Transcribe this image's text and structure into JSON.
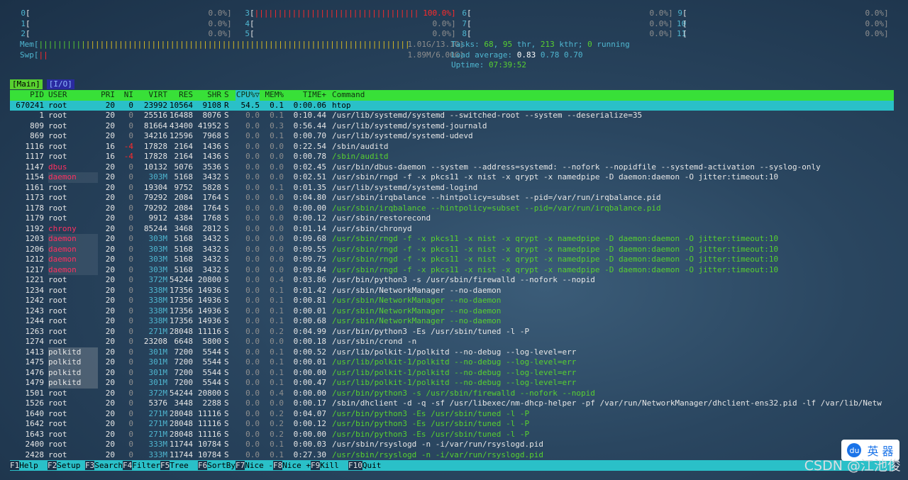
{
  "cpus": [
    {
      "n": "0",
      "pct": "0.0%]",
      "bar": ""
    },
    {
      "n": "1",
      "pct": "0.0%]",
      "bar": ""
    },
    {
      "n": "2",
      "pct": "0.0%]",
      "bar": ""
    },
    {
      "n": "3",
      "pct": "100.0%]",
      "bar": "||||||||||||||||||||||||||||||||||||||||||||||||||||||||||"
    },
    {
      "n": "4",
      "pct": "0.0%]",
      "bar": ""
    },
    {
      "n": "5",
      "pct": "0.0%]",
      "bar": ""
    },
    {
      "n": "6",
      "pct": "0.0%]",
      "bar": ""
    },
    {
      "n": "7",
      "pct": "0.0%]",
      "bar": ""
    },
    {
      "n": "8",
      "pct": "0.0%]",
      "bar": ""
    },
    {
      "n": "9",
      "pct": "0.0%]",
      "bar": ""
    },
    {
      "n": "10",
      "pct": "0.0%]",
      "bar": ""
    },
    {
      "n": "11",
      "pct": "0.0%]",
      "bar": ""
    }
  ],
  "mem": {
    "label": "Mem[",
    "bar": "||||||||||||||||||||||||||||||||||||||||||||||||||||||||||||||||||||||||||||||||||||||||||||||||||||||||||||||||||||||||||||||||||",
    "value": "1.01G/13.1G]"
  },
  "swp": {
    "label": "Swp[",
    "bar": "||",
    "value": "1.89M/6.00G]"
  },
  "tasks": {
    "label": "Tasks: ",
    "tasks": "68",
    "sep1": ", ",
    "thr": "95",
    "thr_label": " thr, ",
    "kthr": "213",
    "kthr_label": " kthr; ",
    "running": "0",
    "running_label": " running"
  },
  "load": {
    "label": "Load average: ",
    "v1": "0.83",
    "v2": "0.78",
    "v3": "0.70"
  },
  "uptime": {
    "label": "Uptime: ",
    "value": "07:39:52"
  },
  "tabs": {
    "main": "[Main]",
    "io": "[I/O]"
  },
  "header": {
    "pid": "PID",
    "user": "USER",
    "pri": "PRI",
    "ni": "NI",
    "virt": "VIRT",
    "res": "RES",
    "shr": "SHR",
    "s": "S",
    "cpu": "CPU%▽",
    "mem": "MEM%",
    "time": "TIME+",
    "cmd": "Command"
  },
  "processes": [
    {
      "pid": "670241",
      "user": "root",
      "pri": "20",
      "ni": "0",
      "virt": "23992",
      "res": "10564",
      "shr": "9108",
      "s": "R",
      "cpu": "54.5",
      "mem": "0.1",
      "time": "0:00.06",
      "cmd": "htop",
      "sel": true
    },
    {
      "pid": "1",
      "user": "root",
      "pri": "20",
      "ni": "0",
      "virt": "25516",
      "res": "16488",
      "shr": "8076",
      "s": "S",
      "cpu": "0.0",
      "mem": "0.1",
      "time": "0:10.44",
      "cmd": "/usr/lib/systemd/systemd --switched-root --system --deserialize=35"
    },
    {
      "pid": "809",
      "user": "root",
      "pri": "20",
      "ni": "0",
      "virt": "81664",
      "res": "43400",
      "shr": "41952",
      "s": "S",
      "cpu": "0.0",
      "mem": "0.3",
      "time": "0:56.44",
      "cmd": "/usr/lib/systemd/systemd-journald"
    },
    {
      "pid": "869",
      "user": "root",
      "pri": "20",
      "ni": "0",
      "virt": "34216",
      "res": "12596",
      "shr": "7968",
      "s": "S",
      "cpu": "0.0",
      "mem": "0.1",
      "time": "0:00.70",
      "cmd": "/usr/lib/systemd/systemd-udevd"
    },
    {
      "pid": "1116",
      "user": "root",
      "pri": "16",
      "ni": "-4",
      "virt": "17828",
      "res": "2164",
      "shr": "1436",
      "s": "S",
      "cpu": "0.0",
      "mem": "0.0",
      "time": "0:22.54",
      "cmd": "/sbin/auditd"
    },
    {
      "pid": "1117",
      "user": "root",
      "pri": "16",
      "ni": "-4",
      "virt": "17828",
      "res": "2164",
      "shr": "1436",
      "s": "S",
      "cpu": "0.0",
      "mem": "0.0",
      "time": "0:00.78",
      "cmd": "/sbin/auditd",
      "thread": true
    },
    {
      "pid": "1147",
      "user": "dbus",
      "pri": "20",
      "ni": "0",
      "virt": "10132",
      "res": "5076",
      "shr": "3536",
      "s": "S",
      "cpu": "0.0",
      "mem": "0.0",
      "time": "0:02.45",
      "cmd": "/usr/bin/dbus-daemon --system --address=systemd: --nofork --nopidfile --systemd-activation --syslog-only"
    },
    {
      "pid": "1154",
      "user": "daemon",
      "pri": "20",
      "ni": "0",
      "virt": "303M",
      "res": "5168",
      "shr": "3432",
      "s": "S",
      "cpu": "0.0",
      "mem": "0.0",
      "time": "0:02.51",
      "cmd": "/usr/sbin/rngd -f -x pkcs11 -x nist -x qrypt -x namedpipe -D daemon:daemon -O jitter:timeout:10"
    },
    {
      "pid": "1161",
      "user": "root",
      "pri": "20",
      "ni": "0",
      "virt": "19304",
      "res": "9752",
      "shr": "5828",
      "s": "S",
      "cpu": "0.0",
      "mem": "0.1",
      "time": "0:01.35",
      "cmd": "/usr/lib/systemd/systemd-logind"
    },
    {
      "pid": "1173",
      "user": "root",
      "pri": "20",
      "ni": "0",
      "virt": "79292",
      "res": "2084",
      "shr": "1764",
      "s": "S",
      "cpu": "0.0",
      "mem": "0.0",
      "time": "0:04.80",
      "cmd": "/usr/sbin/irqbalance --hintpolicy=subset --pid=/var/run/irqbalance.pid"
    },
    {
      "pid": "1178",
      "user": "root",
      "pri": "20",
      "ni": "0",
      "virt": "79292",
      "res": "2084",
      "shr": "1764",
      "s": "S",
      "cpu": "0.0",
      "mem": "0.0",
      "time": "0:00.00",
      "cmd": "/usr/sbin/irqbalance --hintpolicy=subset --pid=/var/run/irqbalance.pid",
      "thread": true
    },
    {
      "pid": "1179",
      "user": "root",
      "pri": "20",
      "ni": "0",
      "virt": "9912",
      "res": "4384",
      "shr": "1768",
      "s": "S",
      "cpu": "0.0",
      "mem": "0.0",
      "time": "0:00.12",
      "cmd": "/usr/sbin/restorecond"
    },
    {
      "pid": "1192",
      "user": "chrony",
      "pri": "20",
      "ni": "0",
      "virt": "85244",
      "res": "3468",
      "shr": "2812",
      "s": "S",
      "cpu": "0.0",
      "mem": "0.0",
      "time": "0:01.14",
      "cmd": "/usr/sbin/chronyd"
    },
    {
      "pid": "1203",
      "user": "daemon",
      "pri": "20",
      "ni": "0",
      "virt": "303M",
      "res": "5168",
      "shr": "3432",
      "s": "S",
      "cpu": "0.0",
      "mem": "0.0",
      "time": "0:09.68",
      "cmd": "/usr/sbin/rngd -f -x pkcs11 -x nist -x qrypt -x namedpipe -D daemon:daemon -O jitter:timeout:10",
      "thread": true
    },
    {
      "pid": "1206",
      "user": "daemon",
      "pri": "20",
      "ni": "0",
      "virt": "303M",
      "res": "5168",
      "shr": "3432",
      "s": "S",
      "cpu": "0.0",
      "mem": "0.0",
      "time": "0:09.55",
      "cmd": "/usr/sbin/rngd -f -x pkcs11 -x nist -x qrypt -x namedpipe -D daemon:daemon -O jitter:timeout:10",
      "thread": true
    },
    {
      "pid": "1212",
      "user": "daemon",
      "pri": "20",
      "ni": "0",
      "virt": "303M",
      "res": "5168",
      "shr": "3432",
      "s": "S",
      "cpu": "0.0",
      "mem": "0.0",
      "time": "0:09.75",
      "cmd": "/usr/sbin/rngd -f -x pkcs11 -x nist -x qrypt -x namedpipe -D daemon:daemon -O jitter:timeout:10",
      "thread": true
    },
    {
      "pid": "1217",
      "user": "daemon",
      "pri": "20",
      "ni": "0",
      "virt": "303M",
      "res": "5168",
      "shr": "3432",
      "s": "S",
      "cpu": "0.0",
      "mem": "0.0",
      "time": "0:09.84",
      "cmd": "/usr/sbin/rngd -f -x pkcs11 -x nist -x qrypt -x namedpipe -D daemon:daemon -O jitter:timeout:10",
      "thread": true
    },
    {
      "pid": "1221",
      "user": "root",
      "pri": "20",
      "ni": "0",
      "virt": "372M",
      "res": "54244",
      "shr": "20800",
      "s": "S",
      "cpu": "0.0",
      "mem": "0.4",
      "time": "0:03.86",
      "cmd": "/usr/bin/python3 -s /usr/sbin/firewalld --nofork --nopid"
    },
    {
      "pid": "1234",
      "user": "root",
      "pri": "20",
      "ni": "0",
      "virt": "338M",
      "res": "17356",
      "shr": "14936",
      "s": "S",
      "cpu": "0.0",
      "mem": "0.1",
      "time": "0:01.42",
      "cmd": "/usr/sbin/NetworkManager --no-daemon"
    },
    {
      "pid": "1242",
      "user": "root",
      "pri": "20",
      "ni": "0",
      "virt": "338M",
      "res": "17356",
      "shr": "14936",
      "s": "S",
      "cpu": "0.0",
      "mem": "0.1",
      "time": "0:00.81",
      "cmd": "/usr/sbin/NetworkManager --no-daemon",
      "thread": true
    },
    {
      "pid": "1243",
      "user": "root",
      "pri": "20",
      "ni": "0",
      "virt": "338M",
      "res": "17356",
      "shr": "14936",
      "s": "S",
      "cpu": "0.0",
      "mem": "0.1",
      "time": "0:00.01",
      "cmd": "/usr/sbin/NetworkManager --no-daemon",
      "thread": true
    },
    {
      "pid": "1244",
      "user": "root",
      "pri": "20",
      "ni": "0",
      "virt": "338M",
      "res": "17356",
      "shr": "14936",
      "s": "S",
      "cpu": "0.0",
      "mem": "0.1",
      "time": "0:00.68",
      "cmd": "/usr/sbin/NetworkManager --no-daemon",
      "thread": true
    },
    {
      "pid": "1263",
      "user": "root",
      "pri": "20",
      "ni": "0",
      "virt": "271M",
      "res": "28048",
      "shr": "11116",
      "s": "S",
      "cpu": "0.0",
      "mem": "0.2",
      "time": "0:04.99",
      "cmd": "/usr/bin/python3 -Es /usr/sbin/tuned -l -P"
    },
    {
      "pid": "1274",
      "user": "root",
      "pri": "20",
      "ni": "0",
      "virt": "23208",
      "res": "6648",
      "shr": "5800",
      "s": "S",
      "cpu": "0.0",
      "mem": "0.0",
      "time": "0:00.18",
      "cmd": "/usr/sbin/crond -n"
    },
    {
      "pid": "1413",
      "user": "polkitd",
      "pri": "20",
      "ni": "0",
      "virt": "301M",
      "res": "7200",
      "shr": "5544",
      "s": "S",
      "cpu": "0.0",
      "mem": "0.1",
      "time": "0:00.52",
      "cmd": "/usr/lib/polkit-1/polkitd --no-debug --log-level=err"
    },
    {
      "pid": "1475",
      "user": "polkitd",
      "pri": "20",
      "ni": "0",
      "virt": "301M",
      "res": "7200",
      "shr": "5544",
      "s": "S",
      "cpu": "0.0",
      "mem": "0.1",
      "time": "0:00.01",
      "cmd": "/usr/lib/polkit-1/polkitd --no-debug --log-level=err",
      "thread": true
    },
    {
      "pid": "1476",
      "user": "polkitd",
      "pri": "20",
      "ni": "0",
      "virt": "301M",
      "res": "7200",
      "shr": "5544",
      "s": "S",
      "cpu": "0.0",
      "mem": "0.1",
      "time": "0:00.00",
      "cmd": "/usr/lib/polkit-1/polkitd --no-debug --log-level=err",
      "thread": true
    },
    {
      "pid": "1479",
      "user": "polkitd",
      "pri": "20",
      "ni": "0",
      "virt": "301M",
      "res": "7200",
      "shr": "5544",
      "s": "S",
      "cpu": "0.0",
      "mem": "0.1",
      "time": "0:00.47",
      "cmd": "/usr/lib/polkit-1/polkitd --no-debug --log-level=err",
      "thread": true
    },
    {
      "pid": "1501",
      "user": "root",
      "pri": "20",
      "ni": "0",
      "virt": "372M",
      "res": "54244",
      "shr": "20800",
      "s": "S",
      "cpu": "0.0",
      "mem": "0.4",
      "time": "0:00.00",
      "cmd": "/usr/bin/python3 -s /usr/sbin/firewalld --nofork --nopid",
      "thread": true
    },
    {
      "pid": "1526",
      "user": "root",
      "pri": "20",
      "ni": "0",
      "virt": "5376",
      "res": "3448",
      "shr": "2288",
      "s": "S",
      "cpu": "0.0",
      "mem": "0.0",
      "time": "0:00.17",
      "cmd": "/sbin/dhclient -d -q -sf /usr/libexec/nm-dhcp-helper -pf /var/run/NetworkManager/dhclient-ens32.pid -lf /var/lib/Netw"
    },
    {
      "pid": "1640",
      "user": "root",
      "pri": "20",
      "ni": "0",
      "virt": "271M",
      "res": "28048",
      "shr": "11116",
      "s": "S",
      "cpu": "0.0",
      "mem": "0.2",
      "time": "0:04.07",
      "cmd": "/usr/bin/python3 -Es /usr/sbin/tuned -l -P",
      "thread": true
    },
    {
      "pid": "1642",
      "user": "root",
      "pri": "20",
      "ni": "0",
      "virt": "271M",
      "res": "28048",
      "shr": "11116",
      "s": "S",
      "cpu": "0.0",
      "mem": "0.2",
      "time": "0:00.12",
      "cmd": "/usr/bin/python3 -Es /usr/sbin/tuned -l -P",
      "thread": true
    },
    {
      "pid": "1643",
      "user": "root",
      "pri": "20",
      "ni": "0",
      "virt": "271M",
      "res": "28048",
      "shr": "11116",
      "s": "S",
      "cpu": "0.0",
      "mem": "0.2",
      "time": "0:00.00",
      "cmd": "/usr/bin/python3 -Es /usr/sbin/tuned -l -P",
      "thread": true
    },
    {
      "pid": "2400",
      "user": "root",
      "pri": "20",
      "ni": "0",
      "virt": "333M",
      "res": "11744",
      "shr": "10784",
      "s": "S",
      "cpu": "0.0",
      "mem": "0.1",
      "time": "0:00.03",
      "cmd": "/usr/sbin/rsyslogd -n -i/var/run/rsyslogd.pid"
    },
    {
      "pid": "2428",
      "user": "root",
      "pri": "20",
      "ni": "0",
      "virt": "333M",
      "res": "11744",
      "shr": "10784",
      "s": "S",
      "cpu": "0.0",
      "mem": "0.1",
      "time": "0:27.30",
      "cmd": "/usr/sbin/rsyslogd -n -i/var/run/rsyslogd.pid",
      "thread": true
    }
  ],
  "footer": [
    {
      "key": "F1",
      "label": "Help  "
    },
    {
      "key": "F2",
      "label": "Setup "
    },
    {
      "key": "F3",
      "label": "Search"
    },
    {
      "key": "F4",
      "label": "Filter"
    },
    {
      "key": "F5",
      "label": "Tree  "
    },
    {
      "key": "F6",
      "label": "SortBy"
    },
    {
      "key": "F7",
      "label": "Nice -"
    },
    {
      "key": "F8",
      "label": "Nice +"
    },
    {
      "key": "F9",
      "label": "Kill  "
    },
    {
      "key": "F10",
      "label": "Quit"
    }
  ],
  "watermark": "CSDN @江池俊",
  "badge": {
    "du": "du",
    "text": "英 器"
  },
  "colors": {
    "green": "#58d030",
    "cyan": "#2ac0c8",
    "red": "#ff2a2a",
    "header": "#38e038"
  }
}
